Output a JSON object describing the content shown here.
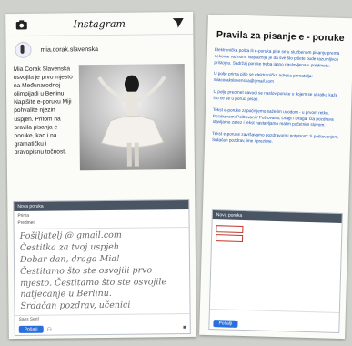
{
  "left": {
    "app_title": "Instagram",
    "handle": "mia.corak.slavenska",
    "caption": "Mia Čorak Slavenska osvojila je prvo mjesto na Međunarodnoj olimpijadi u Berlinu. Napišite e-poruku Miji pohvalite njezin uspjeh. Pritom na pravila pisanja e-poruke, kao i na gramatičku i pravopisnu točnost.",
    "reply_header": "Nova poruka",
    "reply_to_label": "Prima",
    "reply_subject_label": "Predmet",
    "handwriting": [
      "Pošiljatelj @ gmail.com",
      "Čestitka za tvoj uspjeh",
      "Dobar dan, draga Mia!",
      "Čestitamo što ste osvojili prvo",
      "mjesto. Čestitamo što ste osvojile",
      "natjecanje u Berlinu.",
      "Srdačan pozdrav, učenici"
    ],
    "toolbar_label": "Sans Serif",
    "send_label": "Pošalji"
  },
  "right": {
    "title": "Pravila za pisanje e - poruke",
    "paragraphs": [
      "Elektronička pošta ili e-poruka piše se u službenom pisanju prema nekome važnom. Najvažnije je da sve što pišete bude razumljivo i pristojno. Sadržaj poruke treba jasno naslovljena u predmetu.",
      "U polje prima piše se elektronička adresa primatelja: miacorakslavenska@gmail.com",
      "U polje predmet navodi se naslov poruke u kojem se ukratko kaže što će se u poruci pisati.",
      "Tekst e-poruke započinjemo sažetim uvodom - u prvom retku. Pozdravom: Poštovani / Poštovana, Dragi / Draga. Iza pozdrava stavljamo zarez i tekst nastavljamo malim početnim slovom.",
      "Tekst e-poruke završavamo pozdravom i potpisom: S poštovanjem, Srdačan pozdrav, ime i prezime."
    ],
    "reply_header": "Nova poruka",
    "send_label": "Pošalji"
  }
}
